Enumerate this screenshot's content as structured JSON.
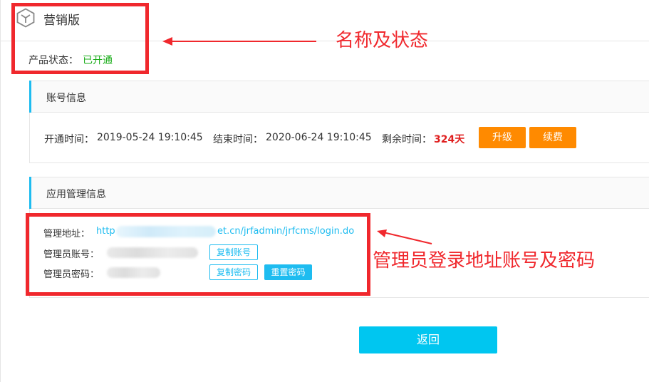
{
  "header": {
    "product_name": "营销版",
    "status_label": "产品状态：",
    "status_value": "已开通"
  },
  "account_panel": {
    "title": "账号信息",
    "start_label": "开通时间：",
    "start_value": "2019-05-24 19:10:45",
    "end_label": "结束时间：",
    "end_value": "2020-06-24 19:10:45",
    "remain_label": "剩余时间：",
    "remain_value": "324天",
    "upgrade_label": "升级",
    "renew_label": "续费"
  },
  "admin_panel": {
    "title": "应用管理信息",
    "url_label": "管理地址：",
    "url_prefix": "http",
    "url_suffix": "et.cn/jrfadmin/jrfcms/login.do",
    "account_label": "管理员账号：",
    "copy_account_label": "复制账号",
    "password_label": "管理员密码：",
    "copy_password_label": "复制密码",
    "reset_password_label": "重置密码"
  },
  "back_label": "返回",
  "annotations": {
    "name_status": "名称及状态",
    "admin_login": "管理员登录地址账号及密码",
    "color": "#f0282d"
  },
  "colors": {
    "accent": "#1ebcf0",
    "orange": "#ff8a00",
    "success": "#1aad19",
    "danger": "#e02020"
  }
}
